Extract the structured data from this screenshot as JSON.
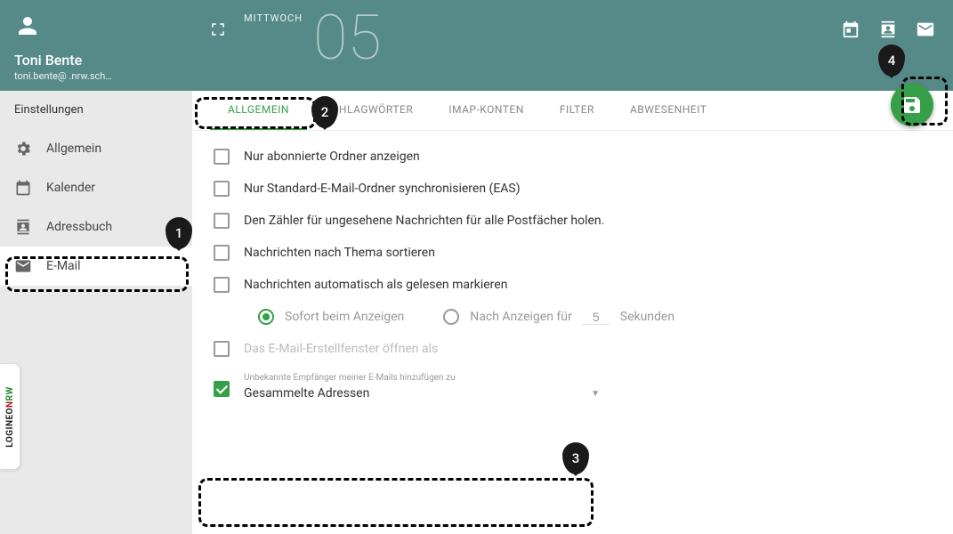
{
  "profile": {
    "name": "Toni Bente",
    "email": "toni.bente@          .nrw.sch…"
  },
  "sidebar": {
    "title": "Einstellungen",
    "items": [
      {
        "label": "Allgemein"
      },
      {
        "label": "Kalender"
      },
      {
        "label": "Adressbuch"
      },
      {
        "label": "E-Mail"
      }
    ]
  },
  "header": {
    "day_name": "MITTWOCH",
    "day_num": "05"
  },
  "tabs": [
    {
      "label": "ALLGEMEIN",
      "active": true
    },
    {
      "label": "SCHLAGWÖRTER"
    },
    {
      "label": "IMAP-KONTEN"
    },
    {
      "label": "FILTER"
    },
    {
      "label": "ABWESENHEIT"
    }
  ],
  "options": {
    "o1": "Nur abonnierte Ordner anzeigen",
    "o2": "Nur Standard-E-Mail-Ordner synchronisieren (EAS)",
    "o3": "Den Zähler für ungesehene Nachrichten für alle Postfächer holen.",
    "o4": "Nachrichten nach Thema sortieren",
    "o5": "Nachrichten automatisch als gelesen markieren",
    "r1": "Sofort beim Anzeigen",
    "r2": "Nach Anzeigen für",
    "r2_val": "5",
    "r2_unit": "Sekunden",
    "o6": "Das E-Mail-Erstellfenster öffnen als",
    "sel_label": "Unbekannte Empfänger meiner E-Mails hinzufügen zu",
    "sel_val": "Gesammelte Adressen"
  },
  "markers": {
    "m1": "1",
    "m2": "2",
    "m3": "3",
    "m4": "4"
  },
  "brand": {
    "p1": "LOGINEO",
    "p2": "N",
    "p3": "RW"
  }
}
